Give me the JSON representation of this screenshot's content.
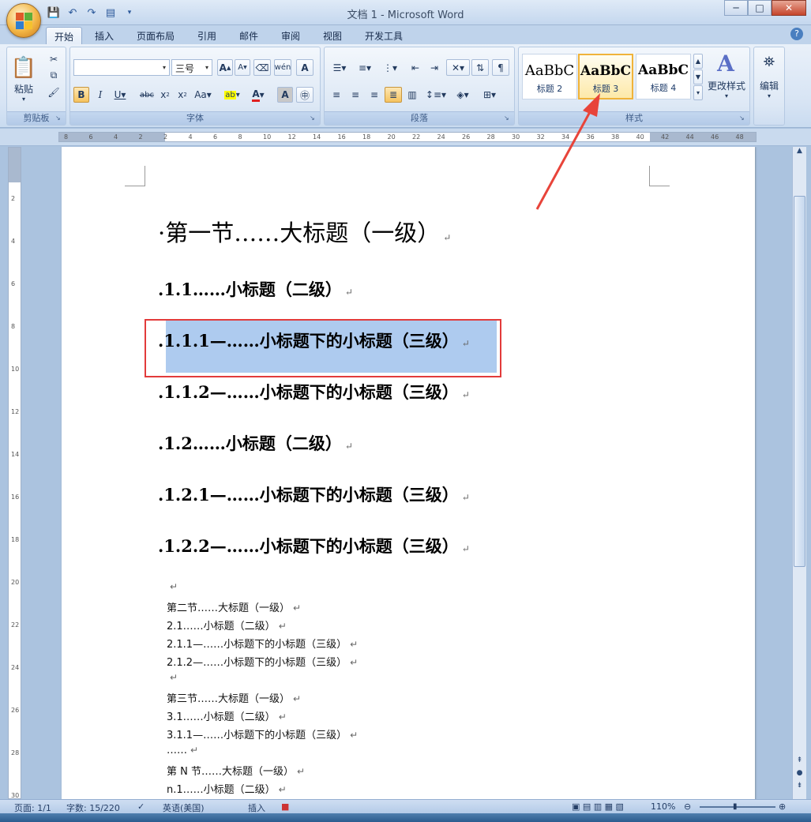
{
  "window": {
    "title": "文档 1 - Microsoft Word",
    "minimize": "─",
    "maximize": "□",
    "close": "✕"
  },
  "tabs": [
    "开始",
    "插入",
    "页面布局",
    "引用",
    "邮件",
    "审阅",
    "视图",
    "开发工具"
  ],
  "ribbon": {
    "clipboard": {
      "label": "剪贴板",
      "paste": "粘贴"
    },
    "font": {
      "label": "字体",
      "font_name": "",
      "font_size": "三号"
    },
    "paragraph": {
      "label": "段落"
    },
    "styles": {
      "label": "样式",
      "items": [
        {
          "sample": "AaBbC",
          "name": "标题 2"
        },
        {
          "sample": "AaBbC",
          "name": "标题 3"
        },
        {
          "sample": "AaBbC",
          "name": "标题 4"
        }
      ],
      "change_styles": "更改样式"
    },
    "editing": {
      "label": "编辑"
    }
  },
  "ruler_numbers": [
    "8",
    "6",
    "4",
    "2",
    "2",
    "4",
    "6",
    "8",
    "10",
    "12",
    "14",
    "16",
    "18",
    "20",
    "22",
    "24",
    "26",
    "28",
    "30",
    "32",
    "34",
    "36",
    "38",
    "40",
    "42",
    "44",
    "46",
    "48"
  ],
  "vruler_numbers": [
    "2",
    "4",
    "6",
    "8",
    "10",
    "12",
    "14",
    "16",
    "18",
    "20",
    "22",
    "24",
    "26",
    "28",
    "30"
  ],
  "document": {
    "heading1": "第一节……大标题（一级）",
    "headings": [
      {
        "level": 2,
        "text": "1.1……小标题（二级）"
      },
      {
        "level": 3,
        "text": "1.1.1—……小标题下的小标题（三级）"
      },
      {
        "level": 3,
        "text": "1.1.2—……小标题下的小标题（三级）"
      },
      {
        "level": 2,
        "text": "1.2……小标题（二级）"
      },
      {
        "level": 3,
        "text": "1.2.1—……小标题下的小标题（三级）"
      },
      {
        "level": 3,
        "text": "1.2.2—……小标题下的小标题（三级）"
      }
    ],
    "body_lines": [
      "",
      "第二节……大标题（一级）",
      "2.1……小标题（二级）",
      "2.1.1—……小标题下的小标题（三级）",
      "2.1.2—……小标题下的小标题（三级）",
      "",
      "第三节……大标题（一级）",
      "3.1……小标题（二级）",
      "3.1.1—……小标题下的小标题（三级）",
      "……",
      "第 N 节……大标题（一级）",
      "n.1……小标题（二级）"
    ],
    "paragraph_mark": "↵"
  },
  "status": {
    "page": "页面: 1/1",
    "words": "字数: 15/220",
    "language": "英语(美国)",
    "mode": "插入",
    "zoom": "110%"
  }
}
